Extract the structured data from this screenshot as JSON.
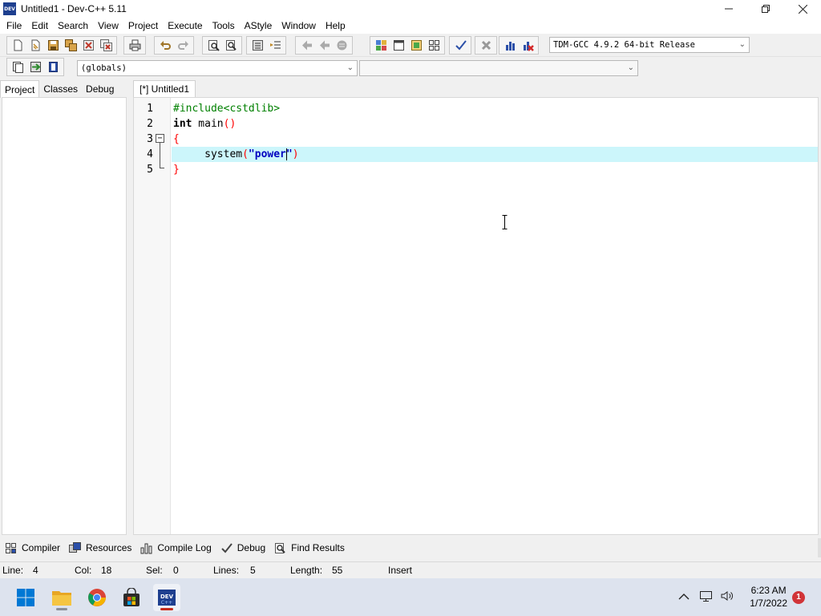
{
  "window": {
    "title": "Untitled1 - Dev-C++ 5.11",
    "app_icon_text": "DEV"
  },
  "menu": [
    "File",
    "Edit",
    "Search",
    "View",
    "Project",
    "Execute",
    "Tools",
    "AStyle",
    "Window",
    "Help"
  ],
  "toolbar": {
    "compiler_select": "TDM-GCC 4.9.2 64-bit Release",
    "scope_select": "(globals)",
    "function_select": ""
  },
  "left_panel": {
    "tabs": [
      "Project",
      "Classes",
      "Debug"
    ],
    "active_tab": "Project"
  },
  "editor": {
    "tab_label": "[*] Untitled1",
    "active_line": 4,
    "lines": [
      {
        "num": "1",
        "tokens": [
          {
            "t": "#include<cstdlib>",
            "k": "pp"
          }
        ]
      },
      {
        "num": "2",
        "tokens": [
          {
            "t": "int",
            "k": "kw"
          },
          {
            "t": " main",
            "k": "id"
          },
          {
            "t": "()",
            "k": "br"
          }
        ]
      },
      {
        "num": "3",
        "tokens": [
          {
            "t": "{",
            "k": "br"
          }
        ]
      },
      {
        "num": "4",
        "tokens": [
          {
            "t": "     system",
            "k": "id"
          },
          {
            "t": "(",
            "k": "br"
          },
          {
            "t": "\"power",
            "k": "str"
          },
          {
            "t": "",
            "k": "caret"
          },
          {
            "t": "\"",
            "k": "str"
          },
          {
            "t": ")",
            "k": "br"
          }
        ]
      },
      {
        "num": "5",
        "tokens": [
          {
            "t": "}",
            "k": "br"
          }
        ]
      }
    ]
  },
  "bottom_tabs": [
    {
      "label": "Compiler",
      "icon": "compiler-icon"
    },
    {
      "label": "Resources",
      "icon": "resources-icon"
    },
    {
      "label": "Compile Log",
      "icon": "compile-log-icon"
    },
    {
      "label": "Debug",
      "icon": "debug-icon"
    },
    {
      "label": "Find Results",
      "icon": "find-results-icon"
    }
  ],
  "status": {
    "line_label": "Line:",
    "line_value": "4",
    "col_label": "Col:",
    "col_value": "18",
    "sel_label": "Sel:",
    "sel_value": "0",
    "lines_label": "Lines:",
    "lines_value": "5",
    "length_label": "Length:",
    "length_value": "55",
    "mode": "Insert"
  },
  "taskbar": {
    "time": "6:23 AM",
    "date": "1/7/2022",
    "notification_count": "1",
    "apps": [
      "start-icon",
      "file-explorer-icon",
      "chrome-icon",
      "store-icon",
      "devcpp-icon"
    ]
  }
}
